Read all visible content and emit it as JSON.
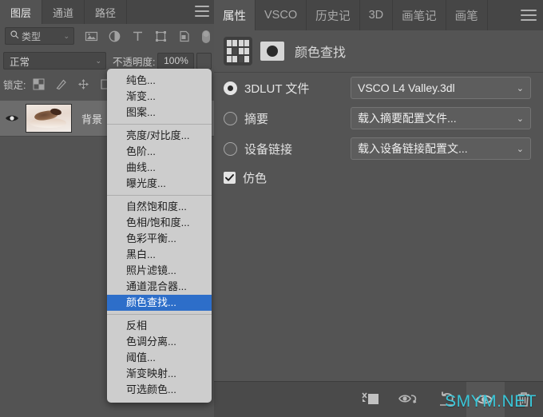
{
  "layers_panel": {
    "tabs": [
      {
        "label": "图层",
        "active": true
      },
      {
        "label": "通道",
        "active": false
      },
      {
        "label": "路径",
        "active": false
      }
    ],
    "menu_icon": "hamburger-menu-icon",
    "filter": {
      "search_icon": "search-icon",
      "kind_label": "类型",
      "chevron": "⌄",
      "icons": [
        "pixel-layer-filter-icon",
        "adjustment-layer-filter-icon",
        "type-layer-filter-icon",
        "shape-layer-filter-icon",
        "smart-object-filter-icon",
        "filter-toggle-switch-icon"
      ]
    },
    "blend": {
      "mode": "正常",
      "chevron": "⌄",
      "opacity_label": "不透明度:",
      "opacity_value": "100%"
    },
    "lock": {
      "label": "锁定:",
      "icons": [
        "lock-transparent-pixels-icon",
        "lock-image-pixels-icon",
        "lock-position-icon",
        "lock-artboard-nesting-icon"
      ]
    },
    "rows": [
      {
        "name": "背景",
        "eye_icon": "eye-visible-icon",
        "thumbnail": "photo-thumbnail"
      }
    ]
  },
  "adjustment_menu": {
    "groups": [
      [
        "纯色...",
        "渐变...",
        "图案..."
      ],
      [
        "亮度/对比度...",
        "色阶...",
        "曲线...",
        "曝光度..."
      ],
      [
        "自然饱和度...",
        "色相/饱和度...",
        "色彩平衡...",
        "黑白...",
        "照片滤镜...",
        "通道混合器...",
        "颜色查找..."
      ],
      [
        "反相",
        "色调分离...",
        "阈值...",
        "渐变映射...",
        "可选颜色..."
      ]
    ],
    "selected": "颜色查找...",
    "highlight_color": "#2d6ec9"
  },
  "properties_panel": {
    "tabs": [
      {
        "label": "属性",
        "active": true
      },
      {
        "label": "VSCO",
        "active": false
      },
      {
        "label": "历史记",
        "active": false
      },
      {
        "label": "3D",
        "active": false
      },
      {
        "label": "画笔记",
        "active": false
      },
      {
        "label": "画笔",
        "active": false
      }
    ],
    "menu_icon": "hamburger-menu-icon",
    "header": {
      "lut_icon": "color-lookup-grid-icon",
      "mask_icon": "layer-mask-icon",
      "title": "颜色查找"
    },
    "options": [
      {
        "label": "3DLUT 文件",
        "selected": true,
        "value": "VSCO L4 Valley.3dl",
        "chevron": "⌄"
      },
      {
        "label": "摘要",
        "selected": false,
        "value": "载入摘要配置文件...",
        "chevron": "⌄"
      },
      {
        "label": "设备链接",
        "selected": false,
        "value": "载入设备链接配置文...",
        "chevron": "⌄"
      }
    ],
    "checkbox": {
      "label": "仿色",
      "checked": true
    },
    "footer_buttons": [
      {
        "name": "clip-to-layer-button",
        "icon": "clip-to-layer-icon",
        "highlighted": false
      },
      {
        "name": "toggle-layer-visibility-preview-button",
        "icon": "eye-with-arrow-icon",
        "highlighted": false
      },
      {
        "name": "reset-adjustment-button",
        "icon": "reset-arrow-icon",
        "highlighted": false
      },
      {
        "name": "toggle-layer-visibility-button",
        "icon": "eye-icon",
        "highlighted": true
      },
      {
        "name": "delete-adjustment-layer-button",
        "icon": "trash-icon",
        "highlighted": false
      }
    ]
  },
  "watermark": {
    "text": "SMYM.NET",
    "color": "#39c6d8"
  }
}
